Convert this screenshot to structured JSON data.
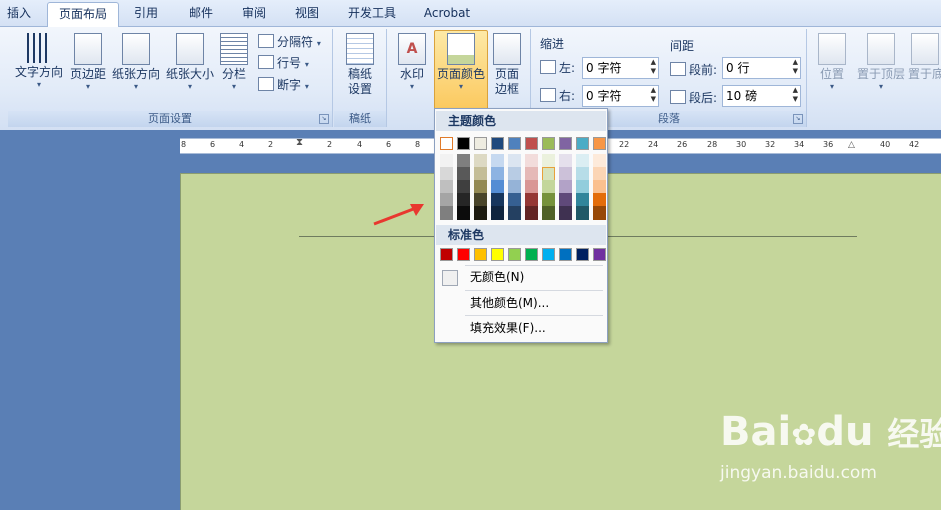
{
  "tabs": [
    {
      "label": "插入",
      "active": false
    },
    {
      "label": "页面布局",
      "active": true
    },
    {
      "label": "引用",
      "active": false
    },
    {
      "label": "邮件",
      "active": false
    },
    {
      "label": "审阅",
      "active": false
    },
    {
      "label": "视图",
      "active": false
    },
    {
      "label": "开发工具",
      "active": false
    },
    {
      "label": "Acrobat",
      "active": false
    }
  ],
  "page_setup": {
    "label": "页面设置",
    "text_direction": "文字方向",
    "margins": "页边距",
    "orientation": "纸张方向",
    "size": "纸张大小",
    "columns": "分栏",
    "breaks": "分隔符",
    "line_numbers": "行号",
    "hyphenation": "断字"
  },
  "manuscript": {
    "label": "稿纸",
    "button_line1": "稿纸",
    "button_line2": "设置"
  },
  "page_background": {
    "watermark": "水印",
    "page_color": "页面颜色",
    "page_borders_line1": "页面",
    "page_borders_line2": "边框"
  },
  "paragraph": {
    "label": "段落",
    "indent_title": "缩进",
    "left_label": "左:",
    "left_value": "0 字符",
    "right_label": "右:",
    "right_value": "0 字符",
    "spacing_title": "间距",
    "before_label": "段前:",
    "before_value": "0 行",
    "after_label": "段后:",
    "after_value": "10 磅"
  },
  "arrange": {
    "position": "位置",
    "bring_front": "置于顶层",
    "send_back": "置于底"
  },
  "ruler": {
    "ticks": [
      "8",
      "6",
      "4",
      "2",
      "2",
      "4",
      "6",
      "8",
      "22",
      "24",
      "26",
      "28",
      "30",
      "32",
      "34",
      "36",
      "40",
      "42"
    ]
  },
  "dropdown": {
    "theme_colors_label": "主题颜色",
    "standard_colors_label": "标准色",
    "no_color": "无颜色(N)",
    "more_colors": "其他颜色(M)...",
    "fill_effects": "填充效果(F)...",
    "theme_top": [
      "#ffffff",
      "#000000",
      "#eeece1",
      "#1f497d",
      "#4f81bd",
      "#c0504d",
      "#9bbb59",
      "#8064a2",
      "#4bacc6",
      "#f79646"
    ],
    "theme_shades": [
      [
        "#f2f2f2",
        "#7f7f7f",
        "#ddd9c3",
        "#c6d9f0",
        "#dbe5f1",
        "#f2dcdb",
        "#ebf1dd",
        "#e5e0ec",
        "#dbeef3",
        "#fdeada"
      ],
      [
        "#d8d8d8",
        "#595959",
        "#c4bd97",
        "#8db3e2",
        "#b8cce4",
        "#e5b9b7",
        "#d7e3bc",
        "#ccc1d9",
        "#b7dde8",
        "#fbd5b5"
      ],
      [
        "#bfbfbf",
        "#3f3f3f",
        "#938953",
        "#548dd4",
        "#95b3d7",
        "#d99694",
        "#c3d69b",
        "#b2a2c7",
        "#92cddc",
        "#fac08f"
      ],
      [
        "#a5a5a5",
        "#262626",
        "#494429",
        "#17365d",
        "#366092",
        "#953734",
        "#76923c",
        "#5f497a",
        "#31859b",
        "#e36c09"
      ],
      [
        "#7f7f7f",
        "#0c0c0c",
        "#1d1b10",
        "#0f243e",
        "#244061",
        "#632423",
        "#4f6128",
        "#3f3151",
        "#205867",
        "#974806"
      ]
    ],
    "standard": [
      "#c00000",
      "#ff0000",
      "#ffc000",
      "#ffff00",
      "#92d050",
      "#00b050",
      "#00b0f0",
      "#0070c0",
      "#002060",
      "#7030a0"
    ]
  },
  "watermark": {
    "brand": "Bai",
    "brand2": "du",
    "cn": "经验",
    "url": "jingyan.baidu.com"
  }
}
